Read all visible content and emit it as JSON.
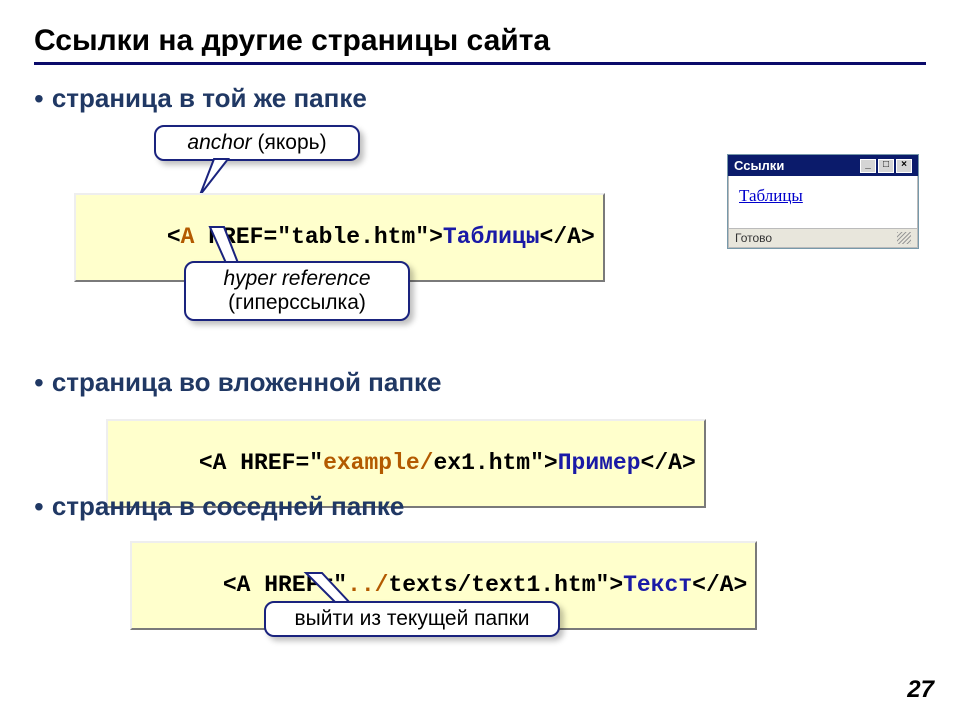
{
  "title": "Ссылки на другие страницы сайта",
  "bullets": {
    "b1": "страница в той же папке",
    "b2": "страница во вложенной папке",
    "b3": "страница в соседней папке"
  },
  "code1": {
    "open": "<",
    "a": "A",
    "mid": " HREF=\"table.htm\">",
    "linktext": "Таблицы",
    "close": "</A>"
  },
  "code2": {
    "pre": "<A HREF=\"",
    "path": "example/",
    "file": "ex1.htm\">",
    "linktext": "Пример",
    "close": "</A>"
  },
  "code3": {
    "pre": "<A HREF=\"",
    "path": "../",
    "file": "texts/text1.htm\">",
    "linktext": "Текст",
    "close": "</A>"
  },
  "callouts": {
    "anchor_main": "anchor",
    "anchor_paren": " (якорь)",
    "href_line1": "hyper reference",
    "href_line2": "(гиперссылка)",
    "exit": "выйти из текущей папки"
  },
  "mini": {
    "title": "Ссылки",
    "link": "Таблицы",
    "status": "Готово"
  },
  "page": "27"
}
